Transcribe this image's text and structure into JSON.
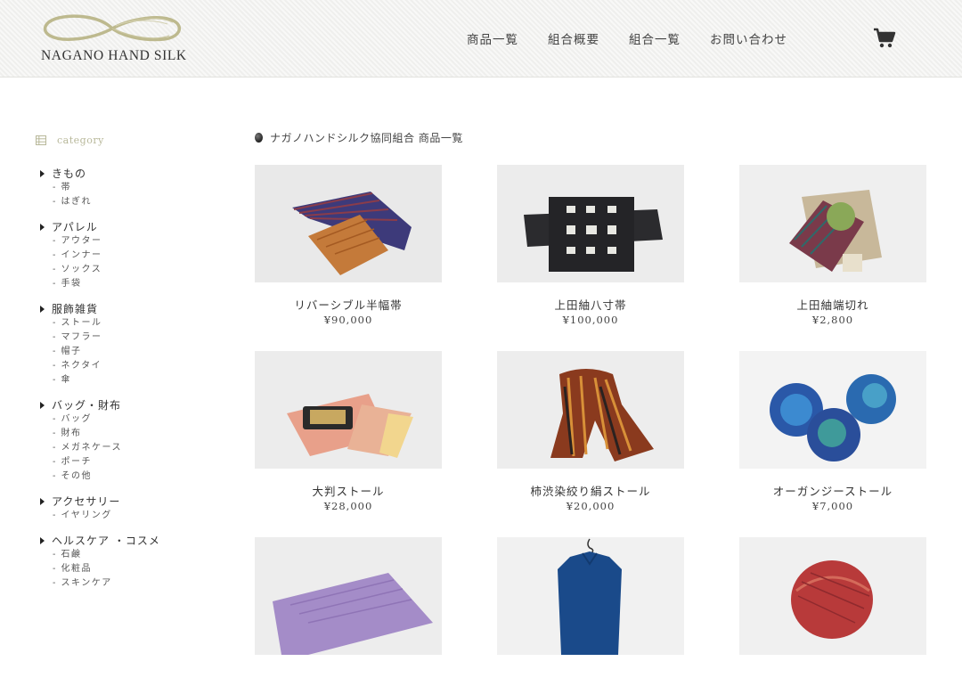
{
  "header": {
    "logo_text": "NAGANO HAND SILK",
    "nav": [
      "商品一覧",
      "組合概要",
      "組合一覧",
      "お問い合わせ"
    ]
  },
  "sidebar": {
    "title": "category",
    "groups": [
      {
        "label": "きもの",
        "items": [
          "- 帯",
          "- はぎれ"
        ]
      },
      {
        "label": "アパレル",
        "items": [
          "- アウター",
          "- インナー",
          "- ソックス",
          "- 手袋"
        ]
      },
      {
        "label": "服飾雑貨",
        "items": [
          "- ストール",
          "- マフラー",
          "- 帽子",
          "- ネクタイ",
          "- 傘"
        ]
      },
      {
        "label": "バッグ・財布",
        "items": [
          "- バッグ",
          "- 財布",
          "- メガネケース",
          "- ポーチ",
          "- その他"
        ]
      },
      {
        "label": "アクセサリー",
        "items": [
          "- イヤリング"
        ]
      },
      {
        "label": "ヘルスケア ・コスメ",
        "items": [
          "- 石鹸",
          "- 化粧品",
          "- スキンケア"
        ]
      }
    ]
  },
  "main": {
    "breadcrumb": "ナガノハンドシルク協同組合 商品一覧",
    "products": [
      {
        "name": "リバーシブル半幅帯",
        "price": "¥90,000"
      },
      {
        "name": "上田紬八寸帯",
        "price": "¥100,000"
      },
      {
        "name": "上田紬端切れ",
        "price": "¥2,800"
      },
      {
        "name": "大判ストール",
        "price": "¥28,000"
      },
      {
        "name": "柿渋染絞り絹ストール",
        "price": "¥20,000"
      },
      {
        "name": "オーガンジーストール",
        "price": "¥7,000"
      },
      {
        "name": "",
        "price": ""
      },
      {
        "name": "",
        "price": ""
      },
      {
        "name": "",
        "price": ""
      }
    ]
  },
  "colors": {
    "header_bg": "#efefed",
    "logo_gold": "#bdb98e",
    "category_accent": "#b8b89a"
  }
}
